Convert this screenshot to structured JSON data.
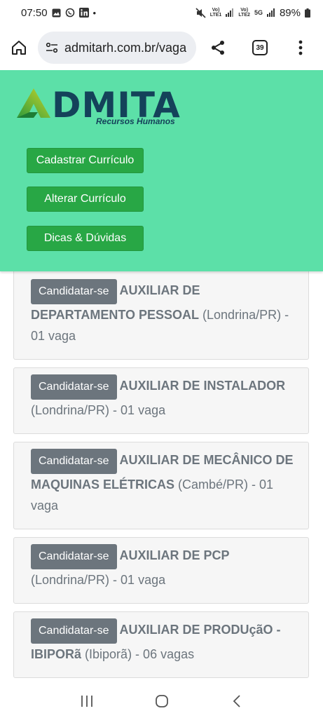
{
  "status_bar": {
    "time": "07:50",
    "dot": "•",
    "volte1": "Vo)\nLTE1",
    "volte2": "Vo)\nLTE2",
    "net": "5G",
    "battery": "89%"
  },
  "browser": {
    "url": "admitarh.com.br/vaga",
    "tab_count": "39"
  },
  "site": {
    "logo_text": "DMITA",
    "logo_sub": "Recursos Humanos",
    "brand_color": "#5ce0a8",
    "menu": [
      {
        "label": "Cadastrar Currículo"
      },
      {
        "label": "Alterar Currículo"
      },
      {
        "label": "Dicas & Dúvidas"
      }
    ]
  },
  "jobs": [
    {
      "apply_label": "Candidatar-se",
      "title": "AUXILIAR DE DEPARTAMENTO PESSOAL",
      "details": " (Londrina/PR) - 01 vaga"
    },
    {
      "apply_label": "Candidatar-se",
      "title": "AUXILIAR DE INSTALADOR",
      "details": " (Londrina/PR) - 01 vaga"
    },
    {
      "apply_label": "Candidatar-se",
      "title": "AUXILIAR DE MECÂNICO DE MAQUINAS ELÉTRICAS",
      "details": " (Cambé/PR) - 01 vaga"
    },
    {
      "apply_label": "Candidatar-se",
      "title": "AUXILIAR DE PCP",
      "details": " (Londrina/PR) - 01 vaga"
    },
    {
      "apply_label": "Candidatar-se",
      "title": "AUXILIAR DE PRODUçãO - IBIPORã",
      "details": " (Ibiporã) - 06 vagas"
    }
  ],
  "nav": {
    "recents_icon": "recents-icon",
    "home_icon": "home-circle-icon",
    "back_icon": "back-chevron-icon"
  }
}
